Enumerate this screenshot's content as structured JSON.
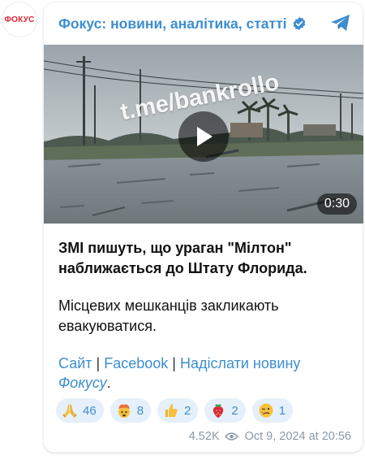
{
  "channel": {
    "avatar_text": "ФОКУС",
    "name": "Фокус: новини, аналітика, статті",
    "verified": true
  },
  "video": {
    "watermark": "t.me/bankrollo",
    "duration": "0:30"
  },
  "post": {
    "headline_line1": "ЗМІ пишуть, що ураган \"Мілтон\"",
    "headline_line2": "наближається до Штату Флорида.",
    "body_line1": "Місцевих мешканців закликають",
    "body_line2": "евакуюватися.",
    "link_site": "Сайт",
    "link_separator": " | ",
    "link_facebook": "Facebook",
    "link_separator2": " | ",
    "link_send_news": "Надіслати новину",
    "link_focus": "Фокусу",
    "link_period": "."
  },
  "reactions": [
    {
      "icon": "folded-hands-icon",
      "count": "46"
    },
    {
      "icon": "exploding-head-icon",
      "count": "8"
    },
    {
      "icon": "thumbs-up-icon",
      "count": "2"
    },
    {
      "icon": "strawberry-icon",
      "count": "2"
    },
    {
      "icon": "woozy-face-icon",
      "count": "1"
    }
  ],
  "meta": {
    "views": "4.52K",
    "date": "Oct 9, 2024 at 20:56"
  },
  "colors": {
    "accent": "#3d8ecf",
    "brand_red": "#e0262f",
    "reaction_bg": "#e5f0fa",
    "meta_gray": "#8a9aa7"
  }
}
